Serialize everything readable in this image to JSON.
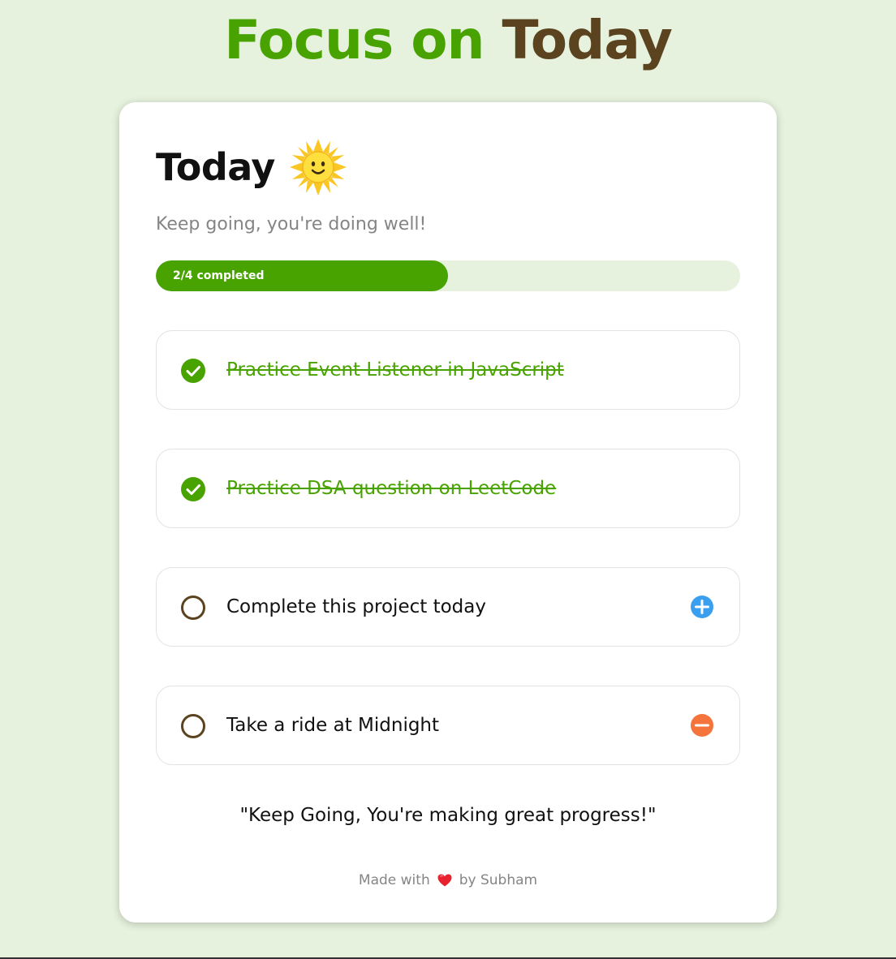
{
  "header": {
    "title_part1": "Focus on",
    "title_part2": "Today"
  },
  "card": {
    "heading": "Today",
    "heading_icon": "sun-with-face-icon",
    "subtitle": "Keep going, you're doing well!",
    "progress": {
      "text": "2/4 completed",
      "completed": 2,
      "total": 4
    },
    "goals": [
      {
        "text": "Practice Event Listener in JavaScript",
        "completed": true,
        "action": null
      },
      {
        "text": "Practice DSA question on LeetCode",
        "completed": true,
        "action": null
      },
      {
        "text": "Complete this project today",
        "completed": false,
        "action": "plus-circle-icon"
      },
      {
        "text": "Take a ride at Midnight",
        "completed": false,
        "action": "minus-circle-icon"
      }
    ],
    "quote": "\"Keep Going, You're making great progress!\"",
    "footer": {
      "made_with": "Made with",
      "heart_icon": "heart-icon",
      "by": "by Subham"
    }
  },
  "colors": {
    "background": "#e6f2dd",
    "accent_green": "#48a300",
    "brown": "#5c4320",
    "plus_blue": "#3b9ff0",
    "minus_orange": "#f4743b"
  }
}
